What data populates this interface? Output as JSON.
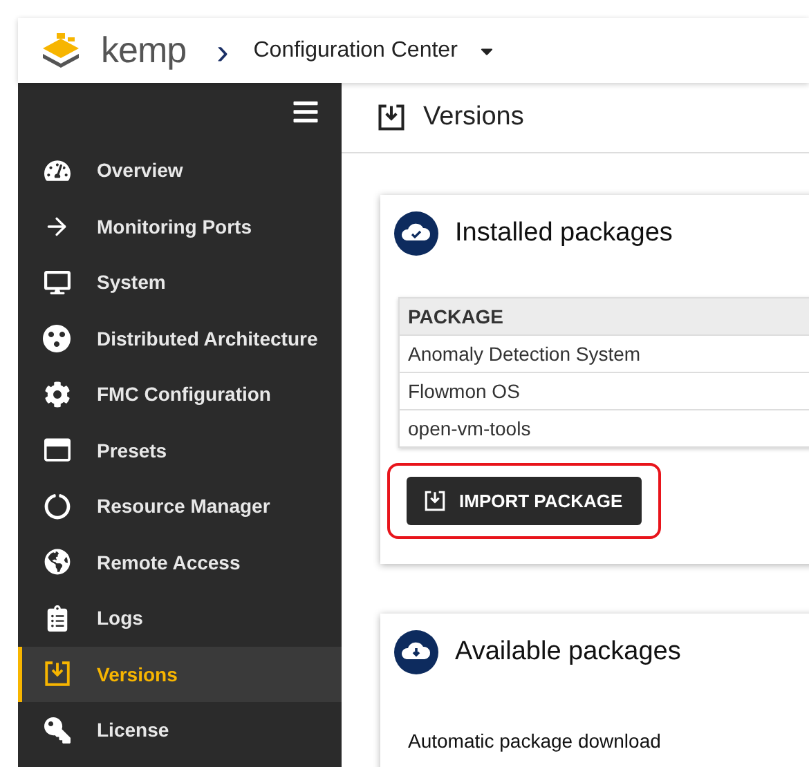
{
  "header": {
    "brand": "kemp",
    "breadcrumb_separator": "›",
    "title": "Configuration Center"
  },
  "sidebar": {
    "items": [
      {
        "label": "Overview",
        "selected": false
      },
      {
        "label": "Monitoring Ports",
        "selected": false
      },
      {
        "label": "System",
        "selected": false
      },
      {
        "label": "Distributed Architecture",
        "selected": false
      },
      {
        "label": "FMC Configuration",
        "selected": false
      },
      {
        "label": "Presets",
        "selected": false
      },
      {
        "label": "Resource Manager",
        "selected": false
      },
      {
        "label": "Remote Access",
        "selected": false
      },
      {
        "label": "Logs",
        "selected": false
      },
      {
        "label": "Versions",
        "selected": true
      },
      {
        "label": "License",
        "selected": false
      }
    ]
  },
  "page": {
    "title": "Versions"
  },
  "installed": {
    "title": "Installed packages",
    "columns": [
      "PACKAGE"
    ],
    "rows": [
      "Anomaly Detection System",
      "Flowmon OS",
      "open-vm-tools"
    ],
    "button": {
      "label": "IMPORT PACKAGE",
      "highlighted": true
    }
  },
  "available": {
    "title": "Available packages",
    "label": "Automatic package download"
  }
}
